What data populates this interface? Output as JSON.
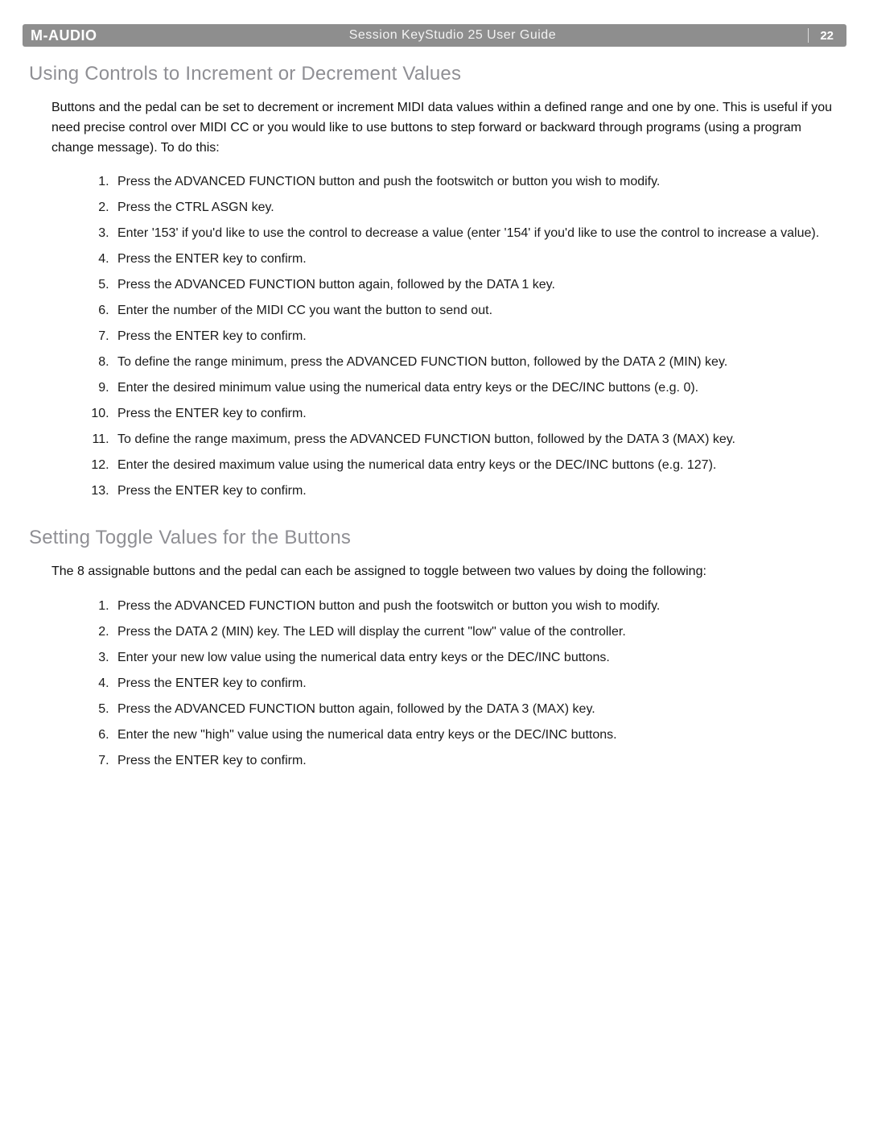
{
  "header": {
    "brand": "M-AUDIO",
    "doc_title": "Session KeyStudio 25 User Guide",
    "page_number": "22"
  },
  "section1": {
    "heading": "Using Controls to Increment or Decrement Values",
    "intro": "Buttons and the pedal can be set to decrement or increment MIDI data values within a defined range and one by one. This is useful if you need precise control over MIDI CC or you would like to use buttons to step forward or backward through programs (using a program change message). To do this:",
    "steps": [
      "Press the ADVANCED FUNCTION button and push the footswitch or button you wish to modify.",
      "Press the CTRL ASGN key.",
      "Enter '153' if you'd like to use the control to decrease a value (enter '154' if you'd like to use the control to increase a value).",
      "Press the ENTER key to confirm.",
      "Press the ADVANCED FUNCTION button again, followed by the DATA 1 key.",
      "Enter the number of the MIDI CC you want the button to send out.",
      "Press the ENTER key to confirm.",
      "To define the range minimum, press the ADVANCED FUNCTION button, followed by the DATA 2 (MIN) key.",
      "Enter the desired minimum value using the numerical data entry keys or the DEC/INC buttons (e.g. 0).",
      "Press the ENTER key to confirm.",
      "To define the range maximum, press the ADVANCED FUNCTION button, followed by the DATA 3 (MAX) key.",
      "Enter the desired maximum value using the numerical data entry keys or the DEC/INC buttons (e.g. 127).",
      "Press the ENTER key to confirm."
    ]
  },
  "section2": {
    "heading": "Setting Toggle Values for the Buttons",
    "intro": "The 8 assignable buttons and the pedal can each be assigned to toggle between two values by doing the following:",
    "steps": [
      "Press the ADVANCED FUNCTION button and push the footswitch or button you wish to modify.",
      "Press the DATA 2 (MIN) key. The LED will display the current \"low\" value of the controller.",
      "Enter your new low value using the numerical data entry keys or the DEC/INC buttons.",
      "Press the ENTER key to confirm.",
      "Press the ADVANCED FUNCTION button again, followed by the DATA 3 (MAX) key.",
      "Enter the new \"high\" value using the numerical data entry keys or the DEC/INC buttons.",
      "Press the ENTER key to confirm."
    ]
  }
}
